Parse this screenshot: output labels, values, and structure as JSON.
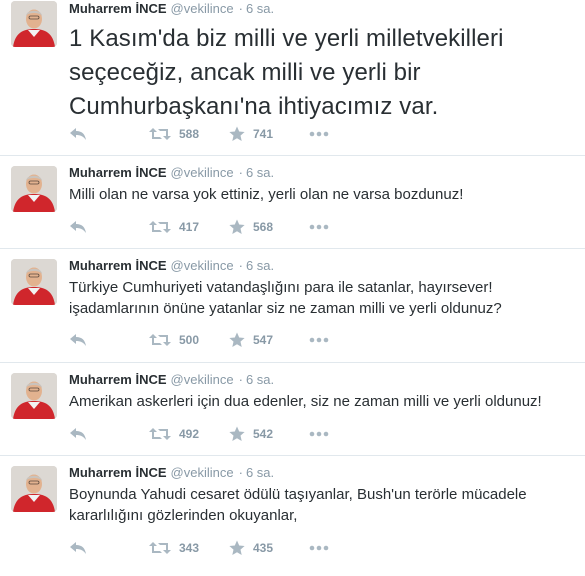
{
  "colors": {
    "text": "#292f33",
    "muted": "#8899a6",
    "divider": "#e1e8ed",
    "avatar_shirt": "#d0262c"
  },
  "icons": {
    "reply": "reply-arrow-icon",
    "retweet": "retweet-icon",
    "favorite": "star-icon",
    "more": "more-dots-icon"
  },
  "tweets": [
    {
      "name": "Muharrem İNCE",
      "handle": "@vekilince",
      "sep": "·",
      "time": "6 sa.",
      "lines": [
        "1 Kasım'da biz milli ve yerli milletvekilleri",
        "seçeceğiz, ancak milli ve yerli bir",
        "Cumhurbaşkanı'na ihtiyacımız var."
      ],
      "retweets": "588",
      "favorites": "741"
    },
    {
      "name": "Muharrem İNCE",
      "handle": "@vekilince",
      "sep": "·",
      "time": "6 sa.",
      "lines": [
        "Milli olan ne varsa yok ettiniz, yerli olan ne varsa bozdunuz!"
      ],
      "retweets": "417",
      "favorites": "568"
    },
    {
      "name": "Muharrem İNCE",
      "handle": "@vekilince",
      "sep": "·",
      "time": "6 sa.",
      "lines": [
        "Türkiye Cumhuriyeti vatandaşlığını para ile satanlar, hayırsever!",
        "işadamlarının önüne yatanlar siz ne zaman milli ve yerli oldunuz?"
      ],
      "retweets": "500",
      "favorites": "547"
    },
    {
      "name": "Muharrem İNCE",
      "handle": "@vekilince",
      "sep": "·",
      "time": "6 sa.",
      "lines": [
        "Amerikan askerleri için dua edenler, siz ne zaman milli ve yerli oldunuz!"
      ],
      "retweets": "492",
      "favorites": "542"
    },
    {
      "name": "Muharrem İNCE",
      "handle": "@vekilince",
      "sep": "·",
      "time": "6 sa.",
      "lines": [
        "Boynunda Yahudi cesaret ödülü taşıyanlar, Bush'un terörle mücadele",
        "kararlılığını gözlerinden okuyanlar,"
      ],
      "retweets": "343",
      "favorites": "435"
    }
  ]
}
